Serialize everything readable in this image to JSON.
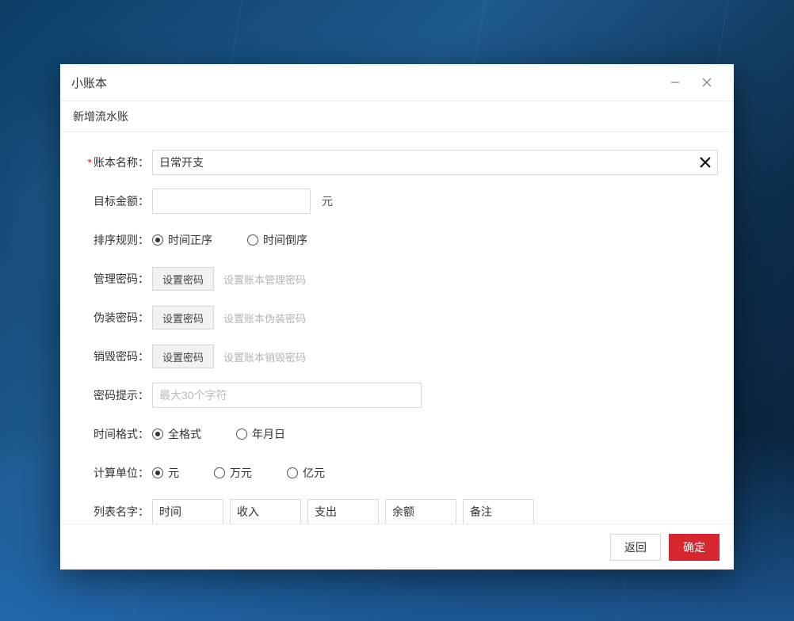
{
  "window": {
    "title": "小账本"
  },
  "section": {
    "title": "新增流水账"
  },
  "form": {
    "name": {
      "label": "账本名称：",
      "value": "日常开支"
    },
    "target_amount": {
      "label": "目标金额：",
      "value": "",
      "unit": "元"
    },
    "sort_rule": {
      "label": "排序规则：",
      "options": [
        "时间正序",
        "时间倒序"
      ],
      "selected": 0
    },
    "admin_pwd": {
      "label": "管理密码：",
      "button": "设置密码",
      "hint": "设置账本管理密码"
    },
    "fake_pwd": {
      "label": "伪装密码：",
      "button": "设置密码",
      "hint": "设置账本伪装密码"
    },
    "destroy_pwd": {
      "label": "销毁密码：",
      "button": "设置密码",
      "hint": "设置账本销毁密码"
    },
    "pwd_hint": {
      "label": "密码提示：",
      "placeholder": "最大30个字符",
      "value": ""
    },
    "time_format": {
      "label": "时间格式：",
      "options": [
        "全格式",
        "年月日"
      ],
      "selected": 0
    },
    "calc_unit": {
      "label": "计算单位：",
      "options": [
        "元",
        "万元",
        "亿元"
      ],
      "selected": 0
    },
    "list_names": {
      "label": "列表名字：",
      "values": [
        "时间",
        "收入",
        "支出",
        "余额",
        "备注"
      ]
    }
  },
  "footer": {
    "back": "返回",
    "ok": "确定"
  }
}
